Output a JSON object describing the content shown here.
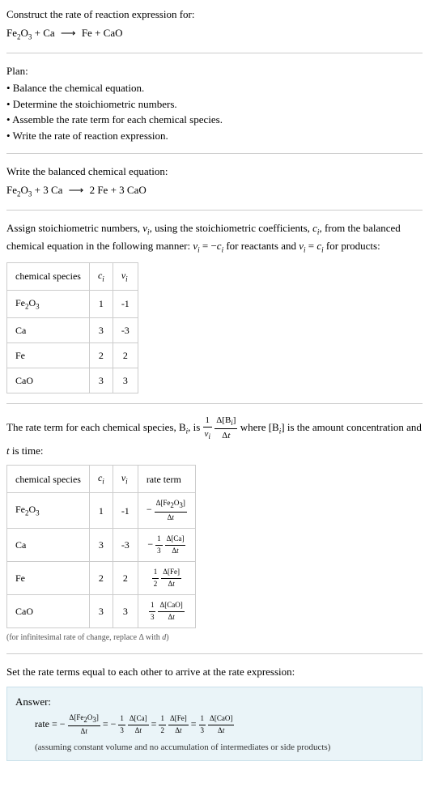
{
  "header": {
    "title": "Construct the rate of reaction expression for:",
    "equation": "Fe₂O₃ + Ca ⟶ Fe + CaO"
  },
  "plan": {
    "title": "Plan:",
    "items": [
      "• Balance the chemical equation.",
      "• Determine the stoichiometric numbers.",
      "• Assemble the rate term for each chemical species.",
      "• Write the rate of reaction expression."
    ]
  },
  "balanced": {
    "title": "Write the balanced chemical equation:",
    "equation": "Fe₂O₃ + 3 Ca ⟶ 2 Fe + 3 CaO"
  },
  "stoich": {
    "intro_1": "Assign stoichiometric numbers, νᵢ, using the stoichiometric coefficients, cᵢ, from the balanced chemical equation in the following manner: νᵢ = −cᵢ for reactants and νᵢ = cᵢ for products:",
    "headers": [
      "chemical species",
      "cᵢ",
      "νᵢ"
    ],
    "rows": [
      {
        "species": "Fe₂O₃",
        "c": "1",
        "v": "-1"
      },
      {
        "species": "Ca",
        "c": "3",
        "v": "-3"
      },
      {
        "species": "Fe",
        "c": "2",
        "v": "2"
      },
      {
        "species": "CaO",
        "c": "3",
        "v": "3"
      }
    ]
  },
  "rateterm": {
    "intro_pre": "The rate term for each chemical species, Bᵢ, is ",
    "intro_post": " where [Bᵢ] is the amount concentration and t is time:",
    "frac1_num": "1",
    "frac1_den": "νᵢ",
    "frac2_num": "Δ[Bᵢ]",
    "frac2_den": "Δt",
    "headers": [
      "chemical species",
      "cᵢ",
      "νᵢ",
      "rate term"
    ],
    "rows": [
      {
        "species": "Fe₂O₃",
        "c": "1",
        "v": "-1",
        "sign": "−",
        "coef_num": "",
        "coef_den": "",
        "num": "Δ[Fe₂O₃]",
        "den": "Δt"
      },
      {
        "species": "Ca",
        "c": "3",
        "v": "-3",
        "sign": "−",
        "coef_num": "1",
        "coef_den": "3",
        "num": "Δ[Ca]",
        "den": "Δt"
      },
      {
        "species": "Fe",
        "c": "2",
        "v": "2",
        "sign": "",
        "coef_num": "1",
        "coef_den": "2",
        "num": "Δ[Fe]",
        "den": "Δt"
      },
      {
        "species": "CaO",
        "c": "3",
        "v": "3",
        "sign": "",
        "coef_num": "1",
        "coef_den": "3",
        "num": "Δ[CaO]",
        "den": "Δt"
      }
    ],
    "note": "(for infinitesimal rate of change, replace Δ with d)"
  },
  "final": {
    "title": "Set the rate terms equal to each other to arrive at the rate expression:",
    "answer_label": "Answer:",
    "rate_label": "rate = ",
    "terms": [
      {
        "sign": "−",
        "coef_num": "",
        "coef_den": "",
        "num": "Δ[Fe₂O₃]",
        "den": "Δt"
      },
      {
        "sign": "−",
        "coef_num": "1",
        "coef_den": "3",
        "num": "Δ[Ca]",
        "den": "Δt"
      },
      {
        "sign": "",
        "coef_num": "1",
        "coef_den": "2",
        "num": "Δ[Fe]",
        "den": "Δt"
      },
      {
        "sign": "",
        "coef_num": "1",
        "coef_den": "3",
        "num": "Δ[CaO]",
        "den": "Δt"
      }
    ],
    "eq": " = ",
    "note": "(assuming constant volume and no accumulation of intermediates or side products)"
  }
}
